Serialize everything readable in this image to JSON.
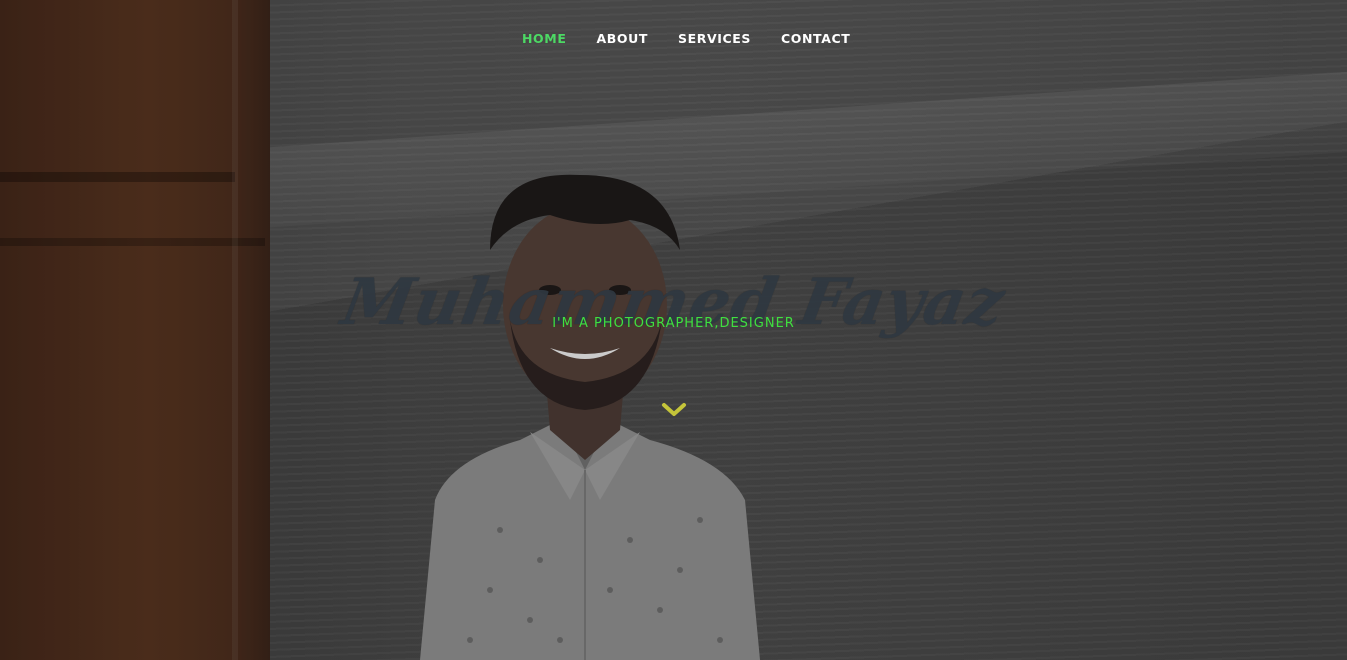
{
  "nav": {
    "items": [
      {
        "label": "HOME",
        "active": true
      },
      {
        "label": "ABOUT",
        "active": false
      },
      {
        "label": "SERVICES",
        "active": false
      },
      {
        "label": "CONTACT",
        "active": false
      }
    ]
  },
  "hero": {
    "name": "Muhammed Fayaz",
    "tagline": "I'M A PHOTOGRAPHER,DESIGNER",
    "scroll_icon": "chevron-down-icon"
  },
  "colors": {
    "accent": "#4cd964",
    "tagline": "#3fe03f",
    "name": "#2f3841",
    "chevron": "#c5c53a",
    "nav_text": "#ffffff"
  }
}
